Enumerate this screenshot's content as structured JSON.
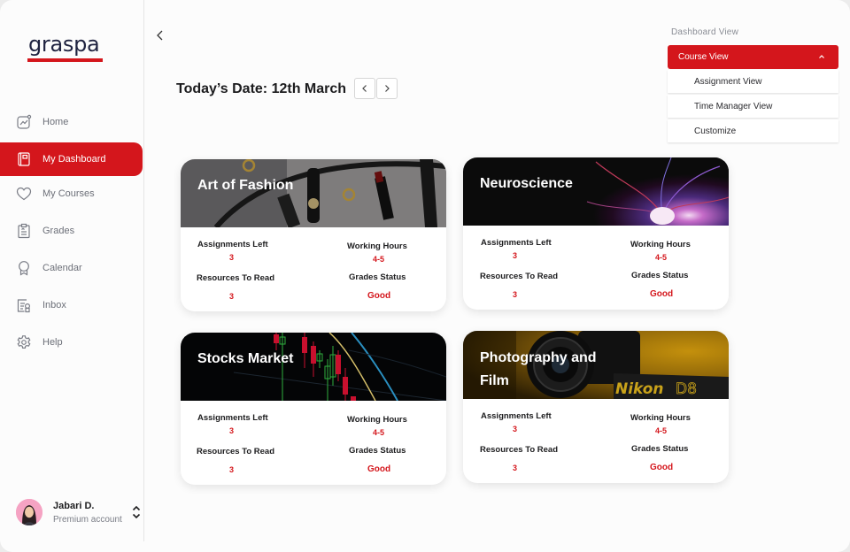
{
  "brand": {
    "name": "graspa",
    "accent": "#d4161c"
  },
  "sidebar": {
    "items": [
      {
        "label": "Home",
        "icon": "chart-line-icon",
        "active": false
      },
      {
        "label": "My Dashboard",
        "icon": "notebook-icon",
        "active": true
      },
      {
        "label": "My Courses",
        "icon": "heart-icon",
        "active": false
      },
      {
        "label": "Grades",
        "icon": "clipboard-icon",
        "active": false
      },
      {
        "label": "Calendar",
        "icon": "award-ribbon-icon",
        "active": false
      },
      {
        "label": "Inbox",
        "icon": "document-badge-icon",
        "active": false
      },
      {
        "label": "Help",
        "icon": "gear-icon",
        "active": false
      }
    ],
    "user": {
      "name": "Jabari D.",
      "plan": "Premium account"
    }
  },
  "header": {
    "date_title": "Today’s Date: 12th March"
  },
  "dashboard_view": {
    "label": "Dashboard View",
    "selected": "Course View",
    "options": [
      "Assignment View",
      "Time Manager View",
      "Customize"
    ]
  },
  "cards": [
    {
      "title": "Art of Fashion",
      "assignments_label": "Assignments Left",
      "assignments_value": "3",
      "hours_label": "Working Hours",
      "hours_value": "4-5",
      "resources_label": "Resources To Read",
      "resources_value": "3",
      "grades_label": "Grades Status",
      "grades_value": "Good"
    },
    {
      "title": "Neuroscience",
      "assignments_label": "Assignments Left",
      "assignments_value": "3",
      "hours_label": "Working Hours",
      "hours_value": "4-5",
      "resources_label": "Resources To Read",
      "resources_value": "3",
      "grades_label": "Grades Status",
      "grades_value": "Good"
    },
    {
      "title": "Stocks Market",
      "assignments_label": "Assignments Left",
      "assignments_value": "3",
      "hours_label": "Working Hours",
      "hours_value": "4-5",
      "resources_label": "Resources To Read",
      "resources_value": "3",
      "grades_label": "Grades Status",
      "grades_value": "Good"
    },
    {
      "title": "Photography and Film",
      "title_line1": "Photography and",
      "title_line2": "Film",
      "assignments_label": "Assignments Left",
      "assignments_value": "3",
      "hours_label": "Working Hours",
      "hours_value": "4-5",
      "resources_label": "Resources To Read",
      "resources_value": "3",
      "grades_label": "Grades Status",
      "grades_value": "Good"
    }
  ]
}
